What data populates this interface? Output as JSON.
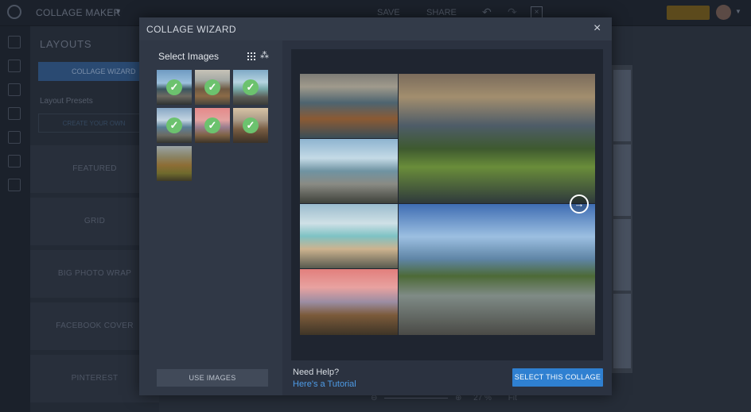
{
  "app": {
    "title": "COLLAGE MAKER",
    "title_caret": "▼",
    "save_label": "SAVE",
    "share_label": "SHARE",
    "undo_glyph": "↶",
    "redo_glyph": "↷",
    "close_glyph": "×"
  },
  "left_panel": {
    "title": "LAYOUTS",
    "wizard_button": "COLLAGE WIZARD",
    "presets_label": "Layout Presets",
    "create_button": "CREATE YOUR OWN",
    "tiles": [
      "FEATURED",
      "GRID",
      "BIG PHOTO WRAP",
      "FACEBOOK COVER",
      "PINTEREST"
    ]
  },
  "canvas": {
    "zoom_text": "27 %",
    "fit_label": "Fit"
  },
  "modal": {
    "title": "COLLAGE WIZARD",
    "close_glyph": "×",
    "select_images_title": "Select Images",
    "shuffle_glyph": "⁂",
    "check_glyph": "✓",
    "use_images_button": "USE IMAGES",
    "next_glyph": "→",
    "help_text": "Need Help?",
    "tutorial_link": "Here's a Tutorial",
    "select_collage_button": "SELECT THIS COLLAGE"
  },
  "thumbnails": [
    {
      "name": "sea-rocks-sky",
      "selected": true
    },
    {
      "name": "sea-stack",
      "selected": true
    },
    {
      "name": "shore-boulders",
      "selected": true
    },
    {
      "name": "rocky-coast",
      "selected": true
    },
    {
      "name": "pink-sunset-arch",
      "selected": true
    },
    {
      "name": "sunset-rocks",
      "selected": true
    },
    {
      "name": "grassy-cliff",
      "selected": false
    }
  ],
  "colors": {
    "accent_blue": "#2f80d1",
    "link_blue": "#4e9be6",
    "check_green": "#6cc26e",
    "modal_bg": "#2b3240"
  }
}
